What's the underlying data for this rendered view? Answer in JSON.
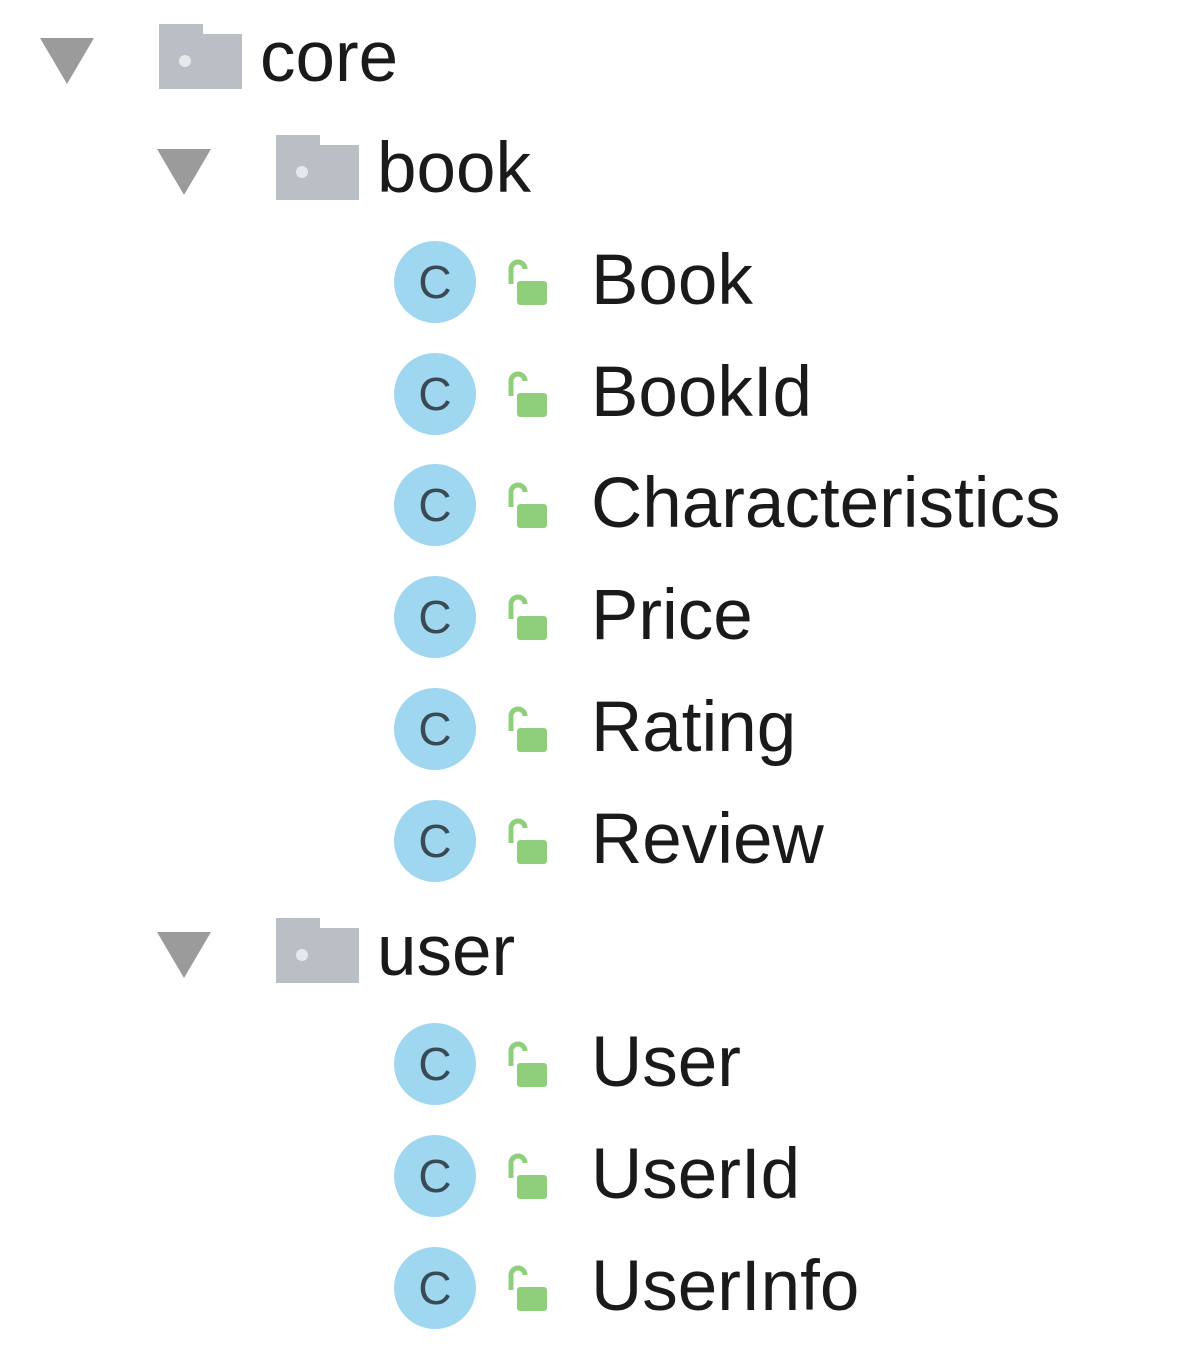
{
  "tree": {
    "packages": [
      {
        "name": "core",
        "expanded": true
      },
      {
        "name": "book",
        "expanded": true,
        "classes": [
          "Book",
          "BookId",
          "Characteristics",
          "Price",
          "Rating",
          "Review"
        ]
      },
      {
        "name": "user",
        "expanded": true,
        "classes": [
          "User",
          "UserId",
          "UserInfo"
        ]
      }
    ],
    "class_icon_letter": "C",
    "icons": {
      "expand": "triangle-down-icon",
      "package": "folder-icon",
      "class": "class-icon",
      "visibility": "unlocked-padlock-icon"
    },
    "colors": {
      "arrow": "#9b9b9b",
      "folder": "#b9bfc4",
      "class_circle": "#9ed7ef",
      "lock": "#8fcf7c",
      "text": "#1a1a1a"
    }
  }
}
